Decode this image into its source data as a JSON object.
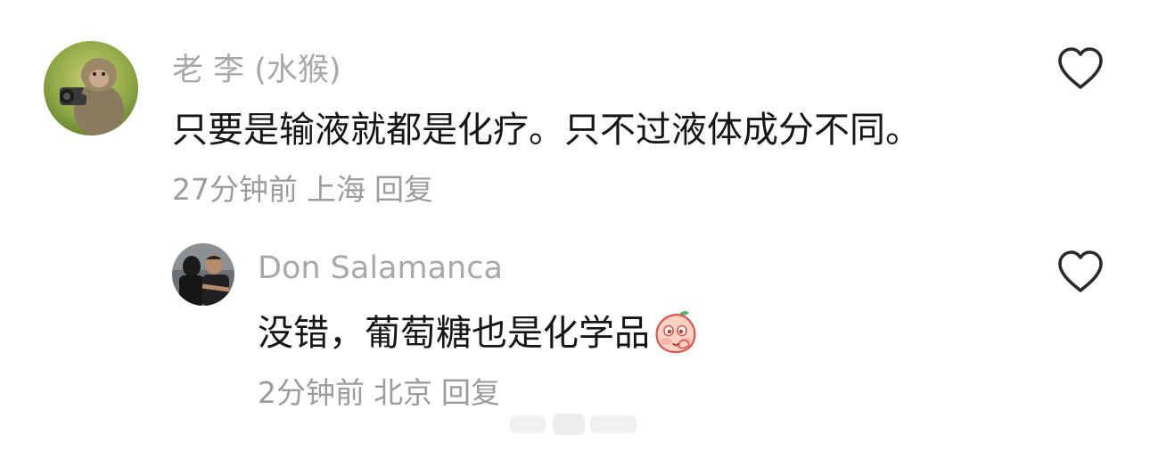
{
  "comments": [
    {
      "username": "老 李 (水猴)",
      "text": "只要是输液就都是化疗。只不过液体成分不同。",
      "time": "27分钟前",
      "location": "上海",
      "reply_label": "回复",
      "avatar": "monkey-with-camera"
    },
    {
      "username": "Don Salamanca",
      "text": "没错，葡萄糖也是化学品",
      "time": "2分钟前",
      "location": "北京",
      "reply_label": "回复",
      "avatar": "two-men-photo",
      "sticker": "peach-emoji-sticker"
    }
  ],
  "icons": {
    "like": "heart-outline-icon"
  },
  "colors": {
    "username": "#a8a8a8",
    "text": "#161616",
    "meta": "#9c9c9c",
    "icon": "#2a2a2a"
  }
}
